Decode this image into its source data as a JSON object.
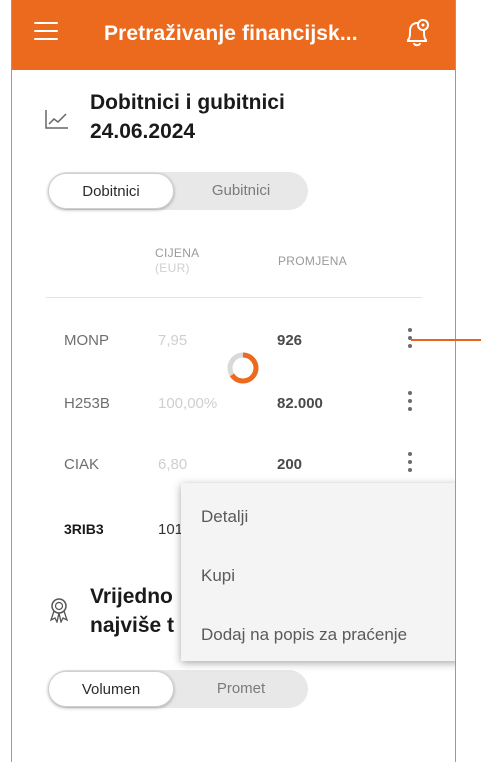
{
  "header": {
    "title": "Pretraživanje financijsk...",
    "menu_icon": "hamburger-icon",
    "bell_icon": "bell-settings-icon",
    "color": "#ec6a1d"
  },
  "gainers_section": {
    "title_line1": "Dobitnici i gubitnici",
    "title_line2": "24.06.2024",
    "icon": "trend-chart-icon",
    "tabs": [
      {
        "label": "Dobitnici",
        "active": true
      },
      {
        "label": "Gubitnici",
        "active": false
      }
    ],
    "columns": {
      "price_line1": "CIJENA",
      "price_line2": "(EUR)",
      "change": "PROMJENA"
    },
    "rows": [
      {
        "symbol": "MONP",
        "price": "7,95",
        "change": "926"
      },
      {
        "symbol": "H253B",
        "price": "100,00%",
        "change": "82.000"
      },
      {
        "symbol": "CIAK",
        "price": "6,80",
        "change": "200"
      },
      {
        "symbol": "3RIB3",
        "price": "101",
        "change": ""
      }
    ]
  },
  "context_menu": {
    "items": [
      "Detalji",
      "Kupi",
      "Dodaj na popis za praćenje"
    ]
  },
  "value_section": {
    "title_line1": "Vrijedno",
    "title_line2": "najviše t",
    "icon": "award-icon",
    "tabs": [
      {
        "label": "Volumen",
        "active": true
      },
      {
        "label": "Promet",
        "active": false
      }
    ]
  },
  "accent_color": "#e8641c"
}
